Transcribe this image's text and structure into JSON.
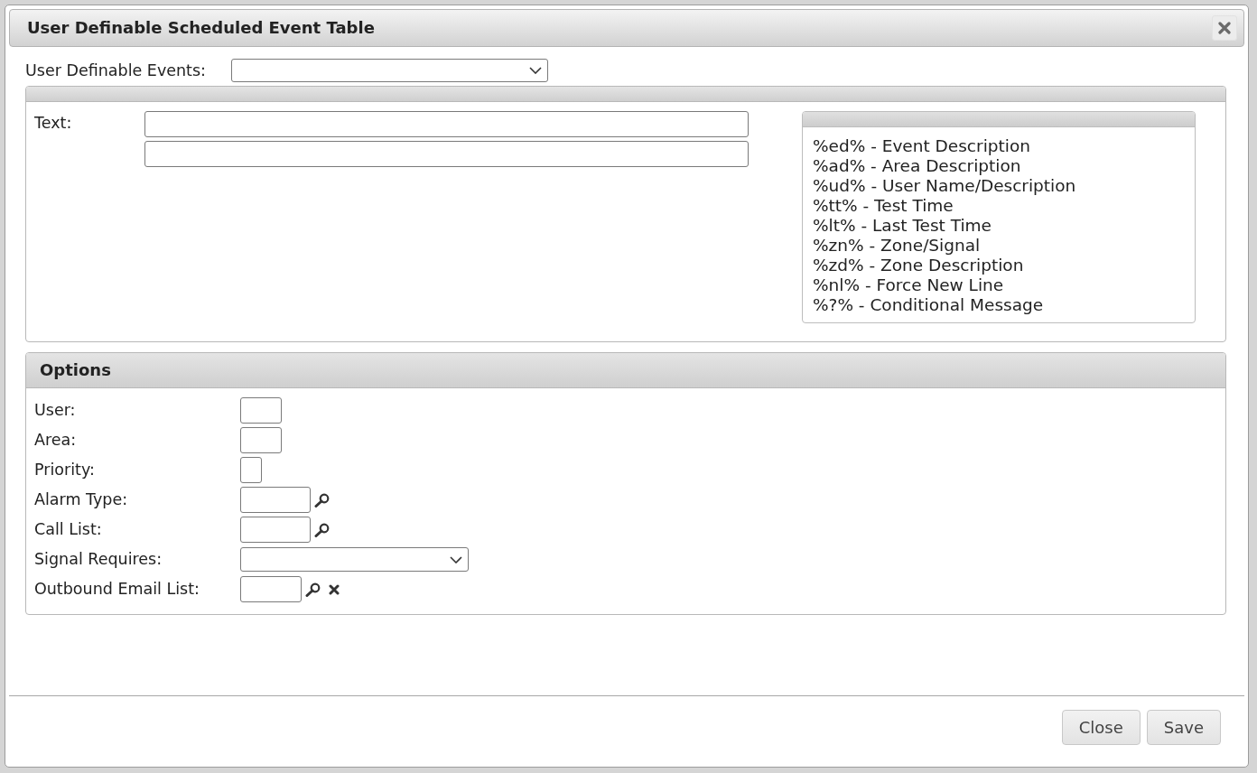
{
  "window": {
    "title": "User Definable Scheduled Event Table"
  },
  "event_selector": {
    "label": "User Definable Events:"
  },
  "message_panel": {
    "label": "Text:",
    "legend": [
      "%ed% - Event Description",
      "%ad% - Area Description",
      "%ud% - User Name/Description",
      "%tt% - Test Time",
      "%lt% - Last Test Time",
      "%zn% - Zone/Signal",
      "%zd% - Zone Description",
      "%nl% - Force New Line",
      "%?% - Conditional Message"
    ]
  },
  "options_panel": {
    "title": "Options",
    "fields": [
      {
        "label": "User:",
        "kind": "short"
      },
      {
        "label": "Area:",
        "kind": "short"
      },
      {
        "label": "Priority:",
        "kind": "digit"
      },
      {
        "label": "Alarm Type:",
        "kind": "lookup"
      },
      {
        "label": "Call List:",
        "kind": "lookup"
      },
      {
        "label": "Signal Requires:",
        "kind": "dropdown"
      },
      {
        "label": "Outbound Email List:",
        "kind": "clearable"
      }
    ]
  },
  "buttons": [
    "Close",
    "Save"
  ]
}
